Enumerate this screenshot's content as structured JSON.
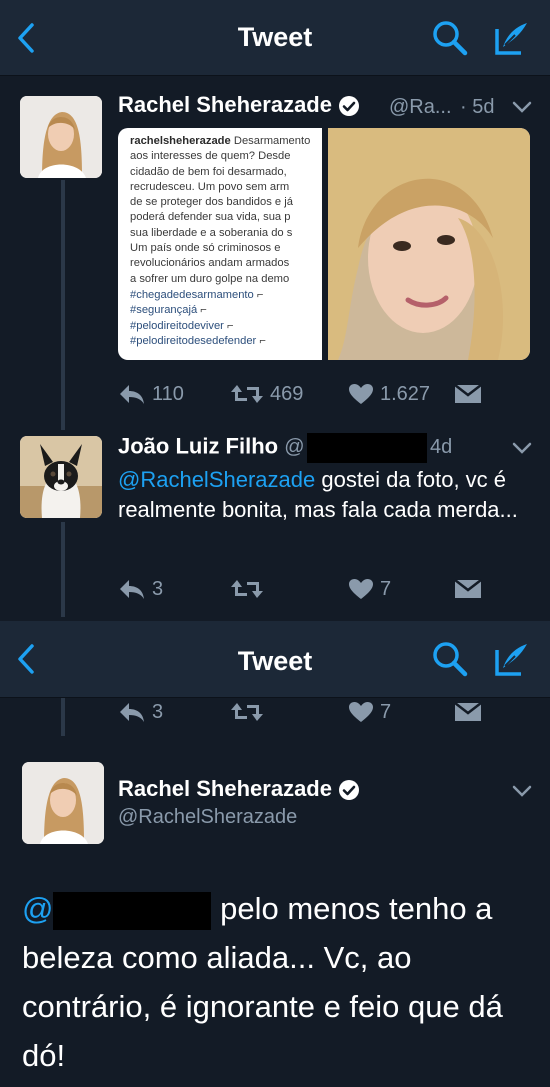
{
  "screens": [
    {
      "nav": {
        "title": "Tweet",
        "back_icon": "back-chevron-icon",
        "search_icon": "search-icon",
        "compose_icon": "compose-icon"
      }
    },
    {
      "nav": {
        "title": "Tweet",
        "back_icon": "back-chevron-icon",
        "search_icon": "search-icon",
        "compose_icon": "compose-icon"
      }
    }
  ],
  "tweet1": {
    "name": "Rachel Sheherazade",
    "handle": "@Ra...",
    "time": "· 5d",
    "verified": true,
    "instagram_text": {
      "username": "rachelsheherazade",
      "lines": [
        " Desarmamento",
        "aos interesses de quem? Desde",
        "cidadão de bem foi desarmado,",
        "recrudesceu. Um povo sem arm",
        "de se proteger dos bandidos e já",
        "poderá defender sua vida, sua p",
        "sua liberdade e a soberania do s",
        "Um país onde só criminosos e",
        "revolucionários andam armados",
        "a sofrer um duro golpe na demo"
      ],
      "hashtags": [
        "#chegadedesarmamento",
        "#segurançajá",
        "#pelodireitodeviver",
        "#pelodireitodesedefender"
      ]
    },
    "actions": {
      "replies": "110",
      "retweets": "469",
      "likes": "1.627"
    }
  },
  "tweet2": {
    "name": "João Luiz Filho",
    "handle": "@",
    "time": "4d",
    "text": {
      "mention": "@RachelSherazade",
      "rest": " gostei da foto, vc é realmente bonita, mas fala cada merda..."
    },
    "actions": {
      "replies": "3",
      "retweets": "",
      "likes": "7"
    }
  },
  "tweet2_dup_actions": {
    "replies": "3",
    "retweets": "",
    "likes": "7"
  },
  "tweet3": {
    "name": "Rachel Sheherazade",
    "handle": "@RachelSherazade",
    "verified": true,
    "text": {
      "mention": "@",
      "rest": " pelo menos tenho a beleza como aliada... Vc, ao contrário, é ignorante e feio que dá dó!"
    }
  },
  "colors": {
    "background": "#131b26",
    "navbar": "#1c2837",
    "accent": "#1da1f2",
    "muted": "#8a9aab"
  }
}
